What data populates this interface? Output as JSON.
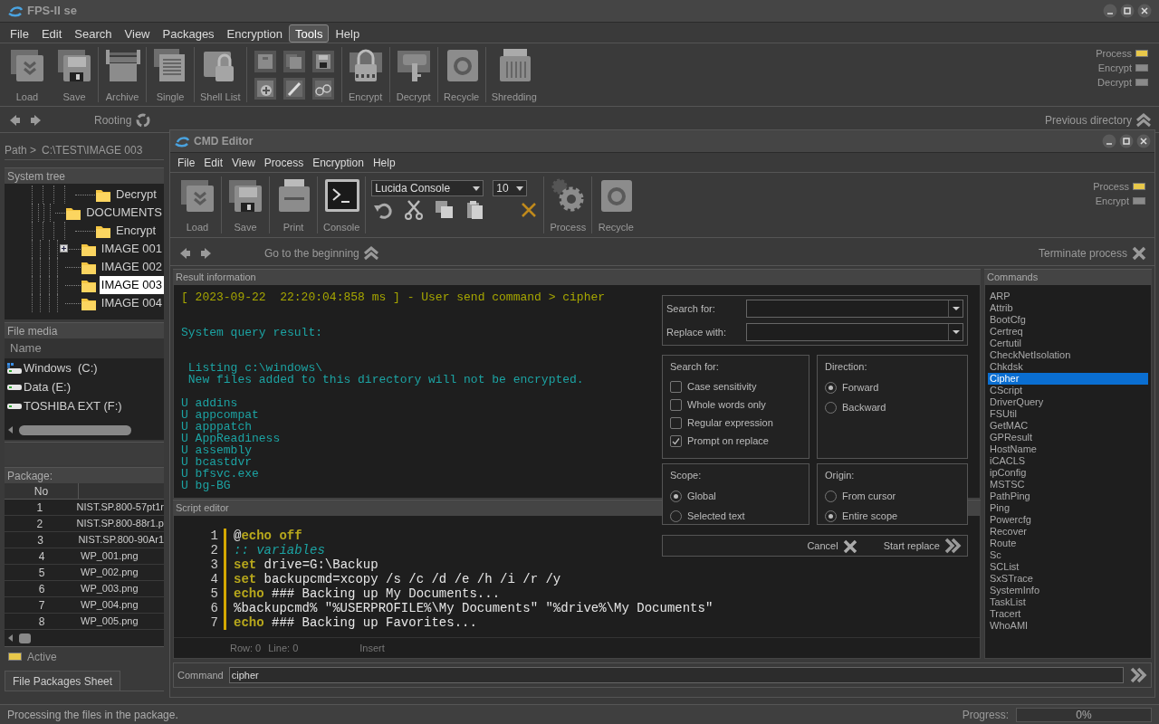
{
  "window": {
    "title": "FPS-II se"
  },
  "menu": [
    {
      "label": "File",
      "selected": false
    },
    {
      "label": "Edit",
      "selected": false
    },
    {
      "label": "Search",
      "selected": false
    },
    {
      "label": "View",
      "selected": false
    },
    {
      "label": "Packages",
      "selected": false
    },
    {
      "label": "Encryption",
      "selected": false
    },
    {
      "label": "Tools",
      "selected": true
    },
    {
      "label": "Help",
      "selected": false
    }
  ],
  "toolbar": [
    {
      "kind": "button",
      "label": "Load"
    },
    {
      "kind": "button",
      "label": "Save"
    },
    {
      "kind": "separator"
    },
    {
      "kind": "button",
      "label": "Archive"
    },
    {
      "kind": "separator"
    },
    {
      "kind": "button",
      "label": "Single"
    },
    {
      "kind": "separator"
    },
    {
      "kind": "button",
      "label": "Shell List"
    },
    {
      "kind": "separator"
    },
    {
      "kind": "icon_grid"
    },
    {
      "kind": "separator"
    },
    {
      "kind": "button",
      "label": "Encrypt"
    },
    {
      "kind": "separator"
    },
    {
      "kind": "button",
      "label": "Decrypt"
    },
    {
      "kind": "separator"
    },
    {
      "kind": "button",
      "label": "Recycle"
    },
    {
      "kind": "separator"
    },
    {
      "kind": "button",
      "label": "Shredding"
    }
  ],
  "indicators": [
    {
      "label": "Process",
      "on": true
    },
    {
      "label": "Encrypt",
      "on": false
    },
    {
      "label": "Decrypt",
      "on": false
    }
  ],
  "nav": {
    "refresh_label": "Rooting",
    "previous_label": "Previous directory"
  },
  "path": {
    "label": "Path >",
    "value": "C:\\TEST\\IMAGE 003"
  },
  "system_tree": {
    "title": "System tree",
    "items": [
      {
        "label": "Decrypt",
        "selected": false,
        "collapsed": false
      },
      {
        "label": "DOCUMENTS",
        "selected": false,
        "collapsed": false
      },
      {
        "label": "Encrypt",
        "selected": false,
        "collapsed": false
      },
      {
        "label": "IMAGE 001",
        "selected": false,
        "collapsed": true
      },
      {
        "label": "IMAGE 002",
        "selected": false,
        "collapsed": false
      },
      {
        "label": "IMAGE 003",
        "selected": true,
        "collapsed": false
      },
      {
        "label": "IMAGE 004",
        "selected": false,
        "collapsed": false
      }
    ]
  },
  "file_media": {
    "title": "File media",
    "column": "Name",
    "drives": [
      {
        "kind": "system",
        "label": "Windows  (C:)"
      },
      {
        "kind": "drive",
        "label": "Data (E:)"
      },
      {
        "kind": "drive",
        "label": "TOSHIBA EXT (F:)"
      }
    ]
  },
  "package": {
    "title": "Package:",
    "columns": [
      "No"
    ],
    "rows": [
      [
        "1",
        "NIST.SP.800-57pt1r"
      ],
      [
        "2",
        "NIST.SP.800-88r1.p"
      ],
      [
        "3",
        "NIST.SP.800-90Ar1"
      ],
      [
        "4",
        "WP_001.png"
      ],
      [
        "5",
        "WP_002.png"
      ],
      [
        "6",
        "WP_003.png"
      ],
      [
        "7",
        "WP_004.png"
      ],
      [
        "8",
        "WP_005.png"
      ]
    ]
  },
  "active": {
    "label": "Active",
    "on": true
  },
  "sheet_tabs": [
    {
      "label": "File Packages Sheet",
      "selected": true
    }
  ],
  "status_bar": {
    "message": "Processing the files in the package.",
    "progress_label": "Progress:",
    "progress_text": "0%",
    "level": 0
  },
  "cmd_editor": {
    "title": "CMD Editor",
    "menu": [
      {
        "label": "File"
      },
      {
        "label": "Edit"
      },
      {
        "label": "View"
      },
      {
        "label": "Process"
      },
      {
        "label": "Encryption"
      },
      {
        "label": "Help"
      }
    ],
    "toolbar": [
      {
        "kind": "button",
        "label": "Load"
      },
      {
        "kind": "separator"
      },
      {
        "kind": "button",
        "label": "Save"
      },
      {
        "kind": "separator"
      },
      {
        "kind": "button",
        "label": "Print"
      },
      {
        "kind": "separator"
      },
      {
        "kind": "button",
        "label": "Console"
      },
      {
        "kind": "separator"
      },
      {
        "kind": "font_tools",
        "font": "Lucida Console",
        "size": "10"
      },
      {
        "kind": "separator"
      },
      {
        "kind": "button",
        "label": "Process"
      },
      {
        "kind": "separator"
      },
      {
        "kind": "button",
        "label": "Recycle"
      }
    ],
    "indicators": [
      {
        "label": "Process",
        "on": true
      },
      {
        "label": "Encrypt",
        "on": false
      }
    ],
    "nav": {
      "start_label": "Go to the beginning",
      "terminate_label": "Terminate process"
    },
    "result": {
      "title": "Result information",
      "blocks": [
        {
          "kind": "header",
          "lines": [
            "[ 2023-09-22  22:20:04:858 ms ] - User send command > cipher"
          ]
        },
        {
          "kind": "output",
          "lines": [
            "System query result:"
          ]
        },
        {
          "kind": "output",
          "lines": [
            " Listing c:\\windows\\",
            " New files added to this directory will not be encrypted."
          ]
        },
        {
          "kind": "output",
          "lines": [
            "U addins",
            "U appcompat",
            "U apppatch",
            "U AppReadiness",
            "U assembly",
            "U bcastdvr",
            "U bfsvc.exe",
            "U bg-BG"
          ]
        }
      ]
    },
    "script": {
      "title": "Script editor",
      "lines": [
        {
          "number": "1",
          "marked": true,
          "segments": [
            {
              "kind": "plain",
              "text": "@"
            },
            {
              "kind": "keyword",
              "text": "echo off"
            }
          ]
        },
        {
          "number": "2",
          "marked": true,
          "segments": [
            {
              "kind": "comment",
              "text": ":: variables"
            }
          ]
        },
        {
          "number": "3",
          "marked": true,
          "segments": [
            {
              "kind": "keyword",
              "text": "set"
            },
            {
              "kind": "plain",
              "text": " drive=G:\\Backup"
            }
          ]
        },
        {
          "number": "4",
          "marked": true,
          "segments": [
            {
              "kind": "keyword",
              "text": "set"
            },
            {
              "kind": "plain",
              "text": " backupcmd=xcopy /s /c /d /e /h /i /r /y"
            }
          ]
        },
        {
          "number": "5",
          "marked": true,
          "segments": [
            {
              "kind": "keyword",
              "text": "echo"
            },
            {
              "kind": "plain",
              "text": " ### Backing up My Documents..."
            }
          ]
        },
        {
          "number": "6",
          "marked": true,
          "segments": [
            {
              "kind": "plain",
              "text": "%backupcmd% \"%USERPROFILE%\\My Documents\" \"%drive%\\My Documents\""
            }
          ]
        },
        {
          "number": "7",
          "marked": true,
          "segments": [
            {
              "kind": "keyword",
              "text": "echo"
            },
            {
              "kind": "plain",
              "text": " ### Backing up Favorites..."
            }
          ]
        }
      ],
      "row_text": "Row: 0",
      "line_text": "Line: 0",
      "mode": "Insert"
    },
    "commands": {
      "title": "Commands",
      "items": [
        {
          "label": "ARP",
          "selected": false
        },
        {
          "label": "Attrib",
          "selected": false
        },
        {
          "label": "BootCfg",
          "selected": false
        },
        {
          "label": "Certreq",
          "selected": false
        },
        {
          "label": "Certutil",
          "selected": false
        },
        {
          "label": "CheckNetIsolation",
          "selected": false
        },
        {
          "label": "Chkdsk",
          "selected": false
        },
        {
          "label": "Cipher",
          "selected": true
        },
        {
          "label": "CScript",
          "selected": false
        },
        {
          "label": "DriverQuery",
          "selected": false
        },
        {
          "label": "FSUtil",
          "selected": false
        },
        {
          "label": "GetMAC",
          "selected": false
        },
        {
          "label": "GPResult",
          "selected": false
        },
        {
          "label": "HostName",
          "selected": false
        },
        {
          "label": "iCACLS",
          "selected": false
        },
        {
          "label": "ipConfig",
          "selected": false
        },
        {
          "label": "MSTSC",
          "selected": false
        },
        {
          "label": "PathPing",
          "selected": false
        },
        {
          "label": "Ping",
          "selected": false
        },
        {
          "label": "Powercfg",
          "selected": false
        },
        {
          "label": "Recover",
          "selected": false
        },
        {
          "label": "Route",
          "selected": false
        },
        {
          "label": "Sc",
          "selected": false
        },
        {
          "label": "SCList",
          "selected": false
        },
        {
          "label": "SxSTrace",
          "selected": false
        },
        {
          "label": "SystemInfo",
          "selected": false
        },
        {
          "label": "TaskList",
          "selected": false
        },
        {
          "label": "Tracert",
          "selected": false
        },
        {
          "label": "WhoAMI",
          "selected": false
        }
      ]
    },
    "command_bar": {
      "label": "Command",
      "value": "cipher"
    },
    "replace_dialog": {
      "search_label": "Search for:",
      "replace_label": "Replace with:",
      "options": {
        "title": "Search for:",
        "items": [
          {
            "label": "Case sensitivity",
            "checked": false
          },
          {
            "label": "Whole words only",
            "checked": false
          },
          {
            "label": "Regular expression",
            "checked": false
          },
          {
            "label": "Prompt on replace",
            "checked": true
          }
        ]
      },
      "direction": {
        "title": "Direction:",
        "items": [
          {
            "label": "Forward",
            "selected": true
          },
          {
            "label": "Backward",
            "selected": false
          }
        ]
      },
      "scope": {
        "title": "Scope:",
        "items": [
          {
            "label": "Global",
            "selected": true
          },
          {
            "label": "Selected text",
            "selected": false
          }
        ]
      },
      "origin": {
        "title": "Origin:",
        "items": [
          {
            "label": "From cursor",
            "selected": false
          },
          {
            "label": "Entire scope",
            "selected": true
          }
        ]
      },
      "cancel": "Cancel",
      "start": "Start replace"
    }
  }
}
